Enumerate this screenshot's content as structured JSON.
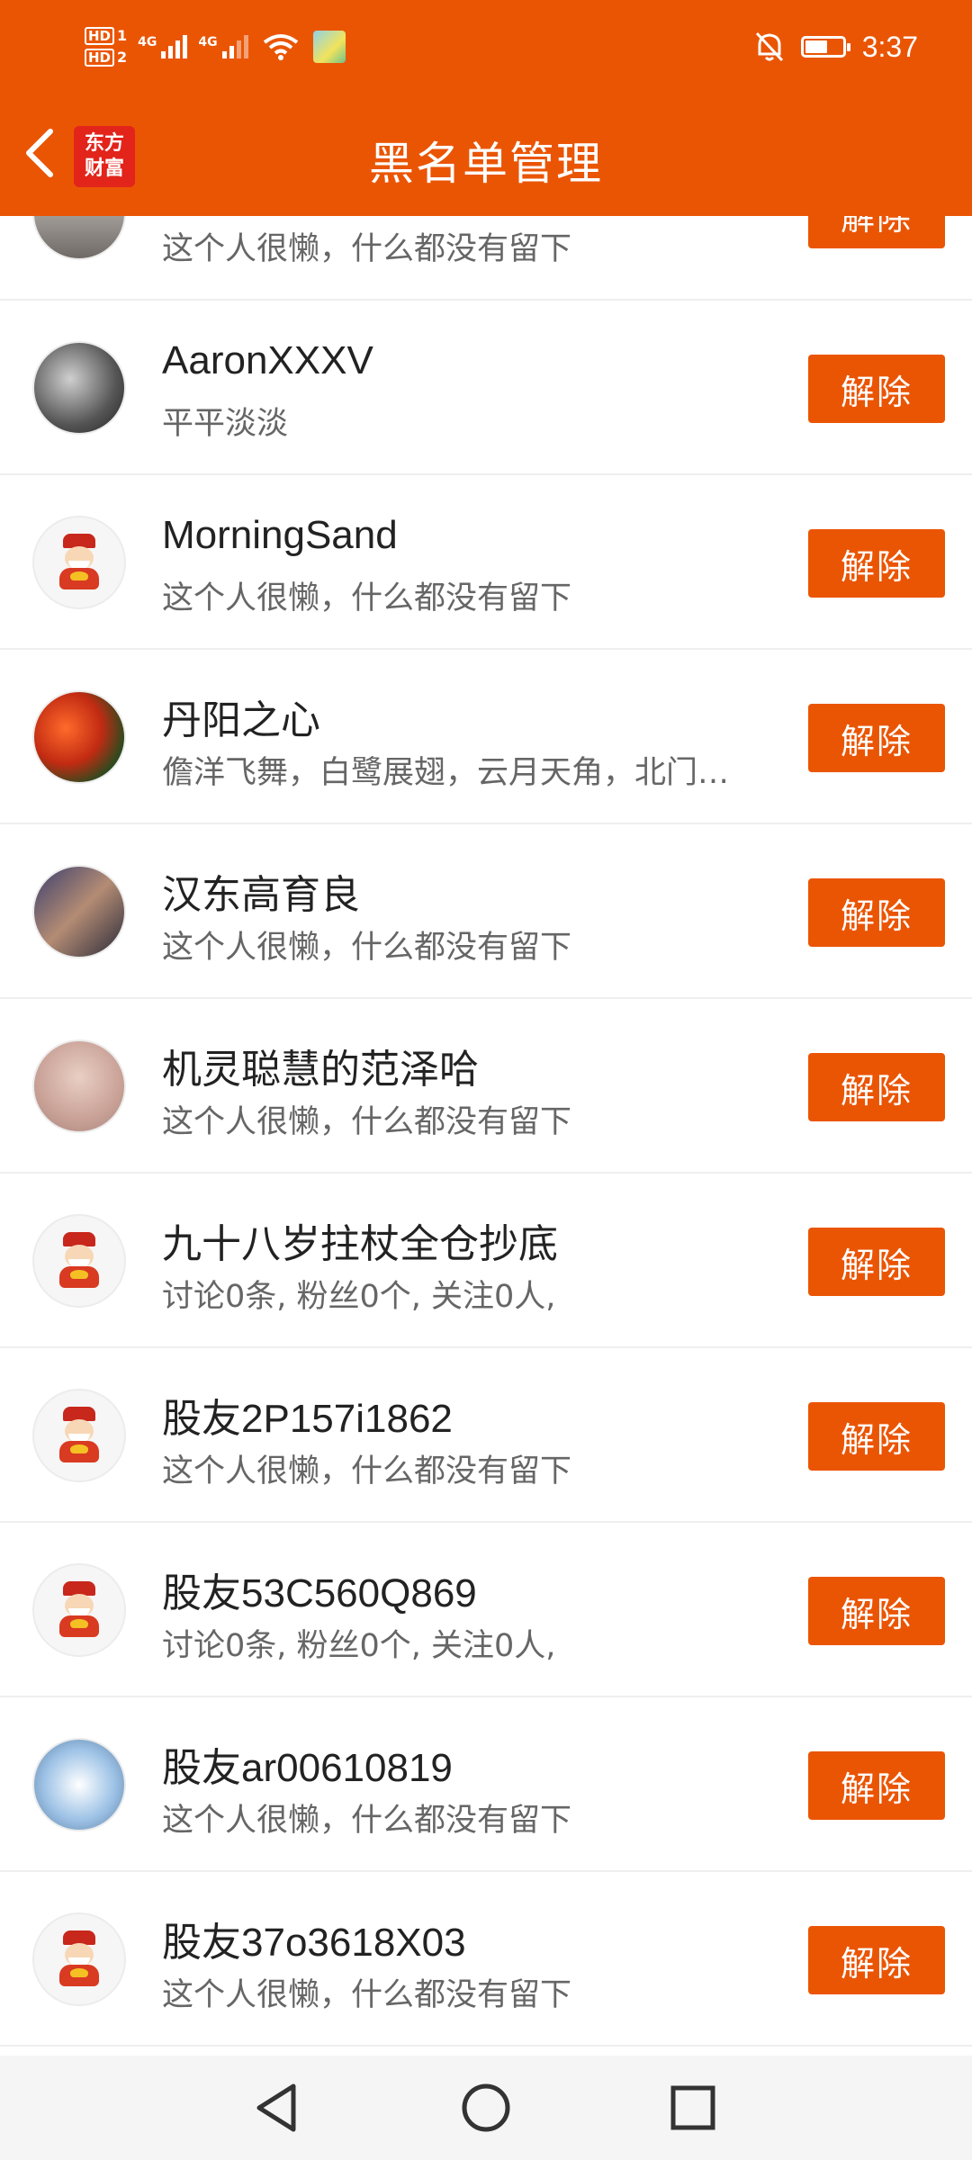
{
  "status_bar": {
    "hd1": "HD",
    "hd1_sub": "1",
    "hd2": "HD",
    "hd2_sub": "2",
    "net1": "4G",
    "net2": "4G",
    "time": "3:37",
    "battery_level": 0.55,
    "icons": [
      "signal-icon",
      "wifi-icon",
      "app-notification-icon",
      "mute-bell-icon",
      "battery-icon"
    ]
  },
  "nav": {
    "title": "黑名单管理",
    "logo_line1": "东方",
    "logo_line2": "财富",
    "back_icon": "chevron-left-icon",
    "colors": {
      "accent": "#EA5504",
      "logo": "#E2241B"
    }
  },
  "list": {
    "button_label": "解除",
    "items": [
      {
        "name": "",
        "signature": "这个人很懒，什么都没有留下",
        "avatar": "photo"
      },
      {
        "name": "AaronXXXV",
        "signature": "平平淡淡",
        "avatar": "photo"
      },
      {
        "name": "MorningSand",
        "signature": "这个人很懒，什么都没有留下",
        "avatar": "default-mascot"
      },
      {
        "name": "丹阳之心",
        "signature": "儋洋飞舞，白鹭展翅，云月天角，北门…",
        "avatar": "photo"
      },
      {
        "name": "汉东高育良",
        "signature": "这个人很懒，什么都没有留下",
        "avatar": "photo"
      },
      {
        "name": "机灵聪慧的范泽哈",
        "signature": "这个人很懒，什么都没有留下",
        "avatar": "photo"
      },
      {
        "name": "九十八岁拄杖全仓抄底",
        "signature": "讨论0条, 粉丝0个, 关注0人,",
        "avatar": "default-mascot"
      },
      {
        "name": "股友2P157i1862",
        "signature": "这个人很懒，什么都没有留下",
        "avatar": "default-mascot"
      },
      {
        "name": "股友53C560Q869",
        "signature": "讨论0条, 粉丝0个, 关注0人,",
        "avatar": "default-mascot"
      },
      {
        "name": "股友ar00610819",
        "signature": "这个人很懒，什么都没有留下",
        "avatar": "photo"
      },
      {
        "name": "股友37o3618X03",
        "signature": "这个人很懒，什么都没有留下",
        "avatar": "default-mascot"
      }
    ]
  },
  "system_nav": {
    "icons": [
      "back-triangle-icon",
      "home-circle-icon",
      "recents-square-icon"
    ]
  }
}
